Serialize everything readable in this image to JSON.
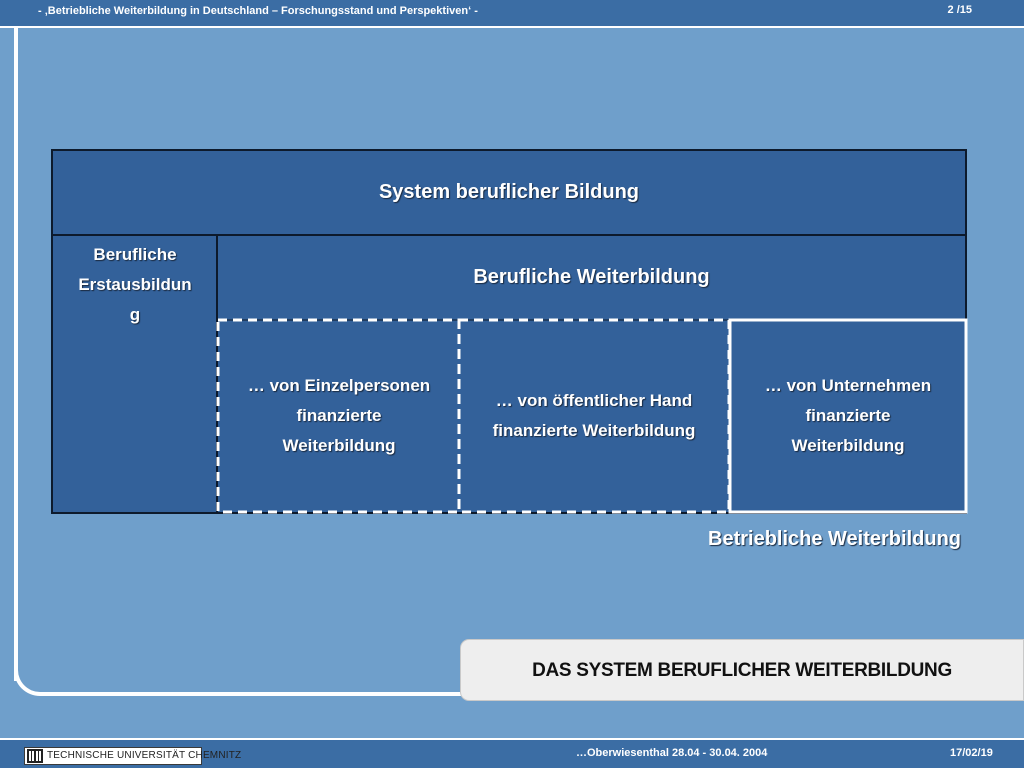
{
  "header": {
    "title": "- ‚Betriebliche Weiterbildung in Deutschland – Forschungsstand und Perspektiven‘ -",
    "page": "2 /15"
  },
  "diagram": {
    "system_title": "System beruflicher Bildung",
    "erstausbildung": [
      "Berufliche",
      "Erstausbildun",
      "g"
    ],
    "weiterbildung_title": "Berufliche Weiterbildung",
    "col_einzel": [
      "… von Einzelpersonen",
      "finanzierte",
      "Weiterbildung"
    ],
    "col_oeffentlich": [
      "… von öffentlicher Hand",
      "finanzierte Weiterbildung"
    ],
    "col_unternehmen": [
      "… von Unternehmen",
      "finanzierte",
      "Weiterbildung"
    ],
    "betriebliche": "Betriebliche Weiterbildung"
  },
  "slide_title": "DAS SYSTEM BERUFLICHER WEITERBILDUNG",
  "footer": {
    "logo_text": "TECHNISCHE UNIVERSITÄT CHEMNITZ",
    "event": "…Oberwiesenthal 28.04 - 30.04. 2004",
    "date": "17/02/19"
  }
}
